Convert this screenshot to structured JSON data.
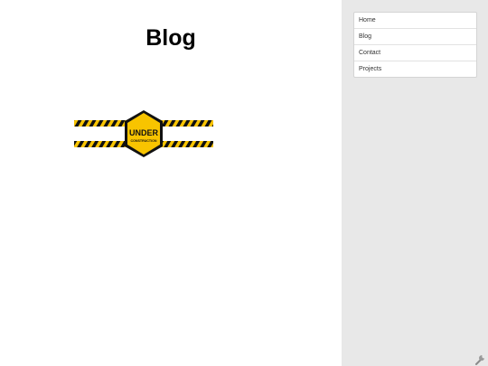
{
  "page": {
    "title": "Blog"
  },
  "banner": {
    "line1": "UNDER",
    "line2": "CONSTRUCTION",
    "colors": {
      "yellow": "#f8c400",
      "black": "#111111"
    }
  },
  "sidebar": {
    "items": [
      {
        "label": "Home"
      },
      {
        "label": "Blog"
      },
      {
        "label": "Contact"
      },
      {
        "label": "Projects"
      }
    ]
  },
  "icons": {
    "corner": "wrench-icon"
  }
}
